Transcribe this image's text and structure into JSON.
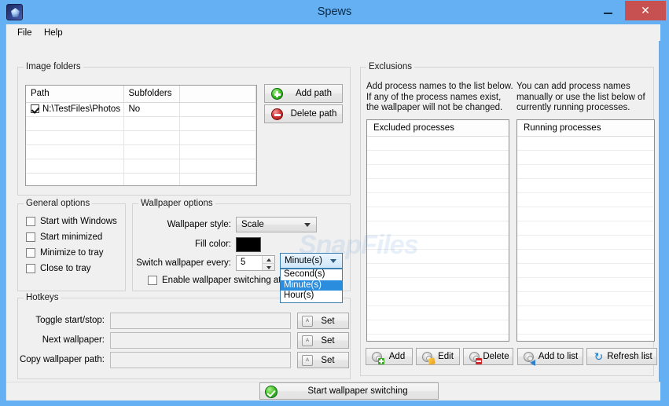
{
  "window": {
    "title": "Spews",
    "icon": "app-gem-icon",
    "minimize": "–",
    "maximize": "▢",
    "close": "✕"
  },
  "menu": {
    "items": [
      {
        "label": "File"
      },
      {
        "label": "Help"
      }
    ]
  },
  "image_folders": {
    "group_title": "Image folders",
    "columns": [
      "Path",
      "Subfolders",
      ""
    ],
    "rows": [
      {
        "checked": true,
        "path": "N:\\TestFiles\\Photos",
        "subfolders": "No"
      }
    ],
    "empty_row_count": 5,
    "add_path_label": "Add path",
    "delete_path_label": "Delete path"
  },
  "general_options": {
    "group_title": "General options",
    "items": [
      {
        "label": "Start with Windows",
        "checked": false
      },
      {
        "label": "Start minimized",
        "checked": false
      },
      {
        "label": "Minimize to tray",
        "checked": false
      },
      {
        "label": "Close to tray",
        "checked": false
      }
    ]
  },
  "wallpaper_options": {
    "group_title": "Wallpaper options",
    "style_label": "Wallpaper style:",
    "style_value": "Scale",
    "fill_color_label": "Fill color:",
    "fill_color_value": "#000000",
    "interval_label": "Switch wallpaper every:",
    "interval_value": "5",
    "units_value": "Minute(s)",
    "units_options": [
      "Second(s)",
      "Minute(s)",
      "Hour(s)"
    ],
    "units_selected_index": 1,
    "startup_label": "Enable wallpaper switching at startup",
    "startup_checked": false
  },
  "hotkeys": {
    "group_title": "Hotkeys",
    "rows": [
      {
        "label": "Toggle start/stop:",
        "value": "",
        "button": "Set"
      },
      {
        "label": "Next wallpaper:",
        "value": "",
        "button": "Set"
      },
      {
        "label": "Copy wallpaper path:",
        "value": "",
        "button": "Set"
      }
    ],
    "key_cap": "A"
  },
  "exclusions": {
    "group_title": "Exclusions",
    "description_left": "Add process names to the list below. If any of the process names exist, the wallpaper will not be changed.",
    "description_right": "You can add process names manually or use the list below of currently running processes.",
    "excluded_header": "Excluded processes",
    "excluded_items": [],
    "running_header": "Running processes",
    "running_items": [],
    "buttons": {
      "add": "Add",
      "edit": "Edit",
      "delete": "Delete",
      "add_to_list": "Add to list",
      "refresh_list": "Refresh list"
    }
  },
  "footer": {
    "start_button": "Start wallpaper switching"
  },
  "watermark": {
    "text_top": "Snap",
    "text_main": "SnapFiles"
  },
  "colors": {
    "title_bar": "#64b0f2",
    "close_button": "#c75050",
    "client_background": "#f0f0f0",
    "selection_blue": "#2a8dde",
    "fill_color_swatch": "#000000"
  }
}
